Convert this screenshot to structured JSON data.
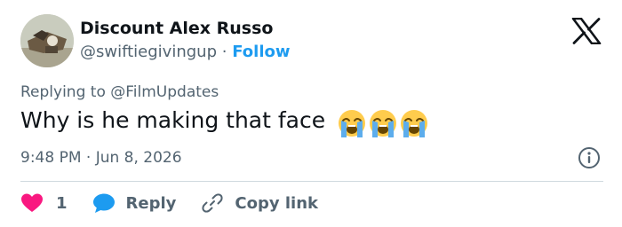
{
  "author": {
    "display_name": "Discount Alex Russo",
    "handle": "@swiftiegivingup",
    "separator": "·",
    "follow_label": "Follow"
  },
  "reply_context": {
    "prefix": "Replying to",
    "mention": "@FilmUpdates"
  },
  "tweet": {
    "text": "Why is he making that face",
    "emojis": [
      "loudly-crying-face",
      "loudly-crying-face",
      "loudly-crying-face"
    ],
    "time": "9:48 PM · Jun 8, 2026"
  },
  "actions": {
    "like_count": "1",
    "reply_label": "Reply",
    "copy_link_label": "Copy link"
  },
  "icons": {
    "logo": "x-logo",
    "info": "info-icon",
    "like": "heart-icon",
    "reply": "speech-bubble-icon",
    "copy": "link-icon"
  },
  "colors": {
    "text": "#0f1419",
    "muted": "#536471",
    "accent": "#1d9bf0",
    "heart": "#f91880",
    "divider": "#cfd9de"
  }
}
